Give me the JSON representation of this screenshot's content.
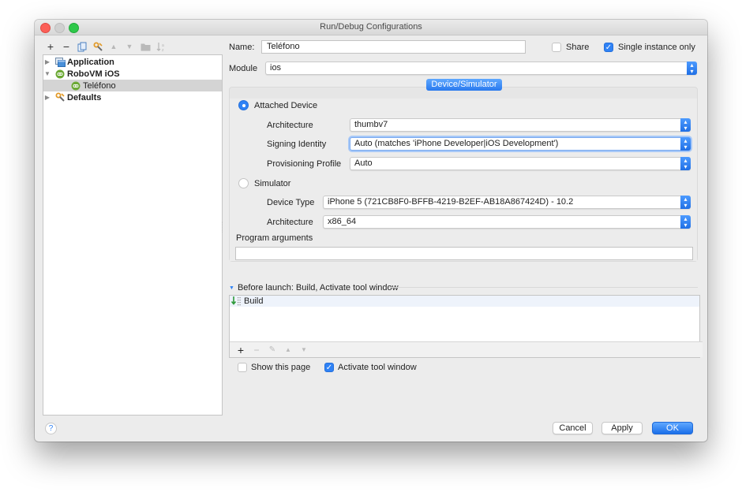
{
  "window": {
    "title": "Run/Debug Configurations"
  },
  "toolbar": {
    "add": "+",
    "remove": "−",
    "copy": "copy-icon",
    "edit_defaults": "wrench-icon",
    "move_up": "▲",
    "move_down": "▼",
    "folder": "folder-icon",
    "sort": "sort-icon"
  },
  "tree": {
    "items": [
      {
        "label": "Application",
        "expanded": false,
        "icon": "application-icon"
      },
      {
        "label": "RoboVM iOS",
        "expanded": true,
        "icon": "robovm-icon"
      },
      {
        "label": "Teléfono",
        "selected": true,
        "icon": "robovm-icon"
      },
      {
        "label": "Defaults",
        "expanded": false,
        "icon": "wrench-icon"
      }
    ]
  },
  "form": {
    "name_label": "Name:",
    "name_value": "Teléfono",
    "share_label": "Share",
    "share_checked": false,
    "single_instance_label": "Single instance only",
    "single_instance_checked": true,
    "module_label": "Module",
    "module_value": "ios"
  },
  "device_tab": {
    "label": "Device/Simulator",
    "attached": {
      "label": "Attached Device",
      "selected": true,
      "architecture_label": "Architecture",
      "architecture_value": "thumbv7",
      "signing_label": "Signing Identity",
      "signing_value": "Auto (matches 'iPhone Developer|iOS Development')",
      "provisioning_label": "Provisioning Profile",
      "provisioning_value": "Auto"
    },
    "simulator": {
      "label": "Simulator",
      "selected": false,
      "device_type_label": "Device Type",
      "device_type_value": "iPhone 5 (721CB8F0-BFFB-4219-B2EF-AB18A867424D) - 10.2",
      "architecture_label": "Architecture",
      "architecture_value": "x86_64"
    },
    "program_args_label": "Program arguments",
    "program_args_value": ""
  },
  "before_launch": {
    "header": "Before launch: Build, Activate tool window",
    "tasks": [
      {
        "label": "Build",
        "icon": "build-icon"
      }
    ],
    "toolbar": {
      "add": "+",
      "remove": "−",
      "edit": "✎",
      "up": "▲",
      "down": "▼"
    },
    "show_page_label": "Show this page",
    "show_page_checked": false,
    "activate_label": "Activate tool window",
    "activate_checked": true
  },
  "footer": {
    "help": "?",
    "cancel": "Cancel",
    "apply": "Apply",
    "ok": "OK"
  },
  "colors": {
    "accent": "#2f82f5",
    "selection": "#d4d4d4",
    "robovm_green": "#6ca935"
  }
}
